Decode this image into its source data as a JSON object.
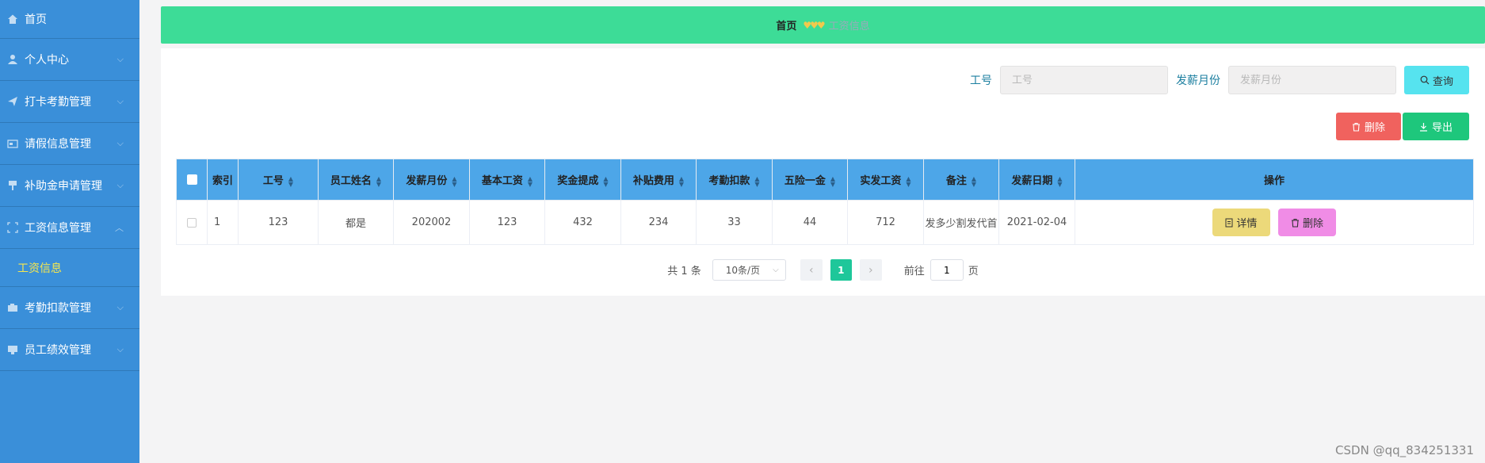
{
  "sidebar": {
    "items": [
      {
        "label": "首页",
        "icon": "home-icon"
      },
      {
        "label": "个人中心",
        "icon": "user-icon"
      },
      {
        "label": "打卡考勤管理",
        "icon": "send-icon"
      },
      {
        "label": "请假信息管理",
        "icon": "card-icon"
      },
      {
        "label": "补助金申请管理",
        "icon": "funnel-icon"
      },
      {
        "label": "工资信息管理",
        "icon": "frame-icon"
      },
      {
        "label": "考勤扣款管理",
        "icon": "camera-icon"
      },
      {
        "label": "员工绩效管理",
        "icon": "monitor-icon"
      }
    ],
    "sub_item": "工资信息"
  },
  "breadcrumb": {
    "home": "首页",
    "hearts": "♥♥♥",
    "current": "工资信息"
  },
  "search": {
    "id_label": "工号",
    "id_placeholder": "工号",
    "month_label": "发薪月份",
    "month_placeholder": "发薪月份",
    "query_button": "查询"
  },
  "actions": {
    "delete": "删除",
    "export": "导出"
  },
  "table": {
    "headers": [
      "索引",
      "工号",
      "员工姓名",
      "发薪月份",
      "基本工资",
      "奖金提成",
      "补贴费用",
      "考勤扣款",
      "五险一金",
      "实发工资",
      "备注",
      "发薪日期",
      "操作"
    ],
    "rows": [
      {
        "index": "1",
        "id": "123",
        "name": "都是",
        "month": "202002",
        "base": "123",
        "bonus": "432",
        "subsidy": "234",
        "deduction": "33",
        "insurance": "44",
        "net": "712",
        "note": "发多少割发代首",
        "date": "2021-02-04",
        "detail_label": "详情",
        "delete_label": "删除"
      }
    ]
  },
  "pagination": {
    "total": "共 1 条",
    "page_size": "10条/页",
    "current_page": "1",
    "goto_label": "前往",
    "goto_value": "1",
    "goto_suffix": "页"
  },
  "watermark": "CSDN @qq_834251331",
  "colors": {
    "sidebar": "#3a8fd9",
    "header": "#3ddc97",
    "table_header": "#4da6e8",
    "accent_sub": "#f6e74f"
  }
}
